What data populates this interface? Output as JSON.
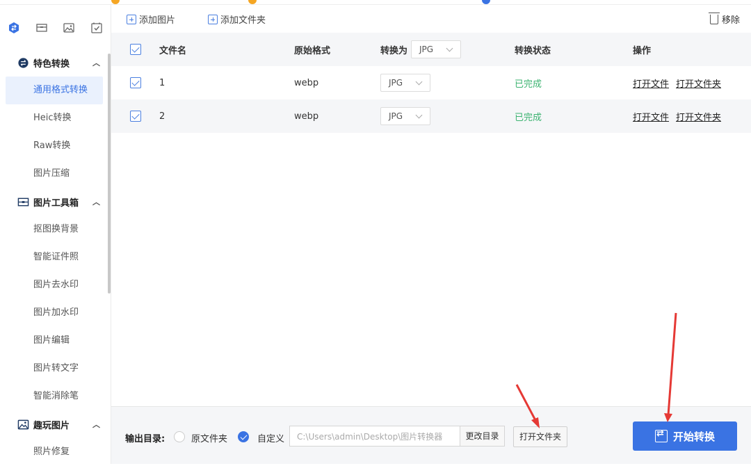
{
  "toolbar": {
    "add_image": "添加图片",
    "add_folder": "添加文件夹",
    "remove": "移除"
  },
  "sidebar": {
    "groups": [
      {
        "title": "特色转换",
        "items": [
          "通用格式转换",
          "Heic转换",
          "Raw转换",
          "图片压缩"
        ]
      },
      {
        "title": "图片工具箱",
        "items": [
          "抠图换背景",
          "智能证件照",
          "图片去水印",
          "图片加水印",
          "图片编辑",
          "图片转文字",
          "智能消除笔"
        ]
      },
      {
        "title": "趣玩图片",
        "items": [
          "照片修复"
        ]
      }
    ],
    "active_item": "通用格式转换",
    "top_icons": [
      "convert-icon",
      "toolbox-icon",
      "image-icon",
      "check-icon"
    ]
  },
  "table": {
    "headers": {
      "filename": "文件名",
      "original_format": "原始格式",
      "convert_to": "转换为",
      "convert_to_value": "JPG",
      "status": "转换状态",
      "actions": "操作"
    },
    "rows": [
      {
        "name": "1",
        "format": "webp",
        "target": "JPG",
        "status": "已完成",
        "open_file": "打开文件",
        "open_folder": "打开文件夹"
      },
      {
        "name": "2",
        "format": "webp",
        "target": "JPG",
        "status": "已完成",
        "open_file": "打开文件",
        "open_folder": "打开文件夹"
      }
    ]
  },
  "bottom": {
    "output_label": "输出目录:",
    "option_original": "原文件夹",
    "option_custom": "自定义",
    "selected_option": "自定义",
    "path": "C:\\Users\\admin\\Desktop\\图片转换器",
    "change_dir": "更改目录",
    "open_folder": "打开文件夹",
    "start": "开始转换"
  },
  "colors": {
    "accent": "#3a73e3",
    "success": "#3cb371",
    "arrow": "#e53935"
  }
}
